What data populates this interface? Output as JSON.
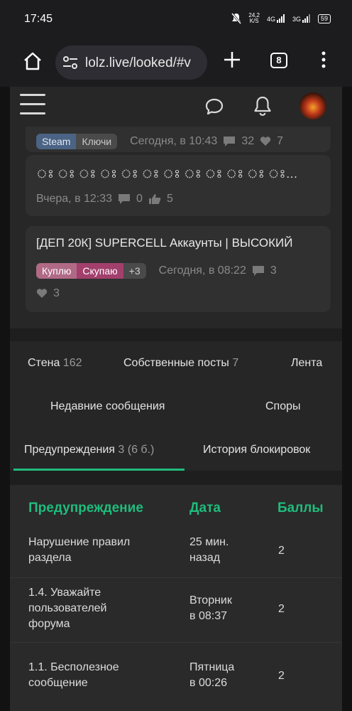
{
  "status_bar": {
    "time": "17:45",
    "net_speed": "24,2",
    "net_unit": "K/S",
    "net_type_1": "4G",
    "net_type_2": "3G",
    "battery": "59"
  },
  "browser": {
    "url": "lolz.live/looked/#v",
    "tab_count": "8"
  },
  "threads": [
    {
      "tags": [
        "Steam",
        "Ключи"
      ],
      "time": "Сегодня, в 10:43",
      "replies": "32",
      "likes": "7"
    },
    {
      "title": "ঃ ঃ ঃ ঃ ঃ ঃ ঃ ঃ ঃ ঃ ঃ ঃ ঃ ঃ ঃ ঃ ঃ ঃ ঃ ঃ ঃ ঃ ঃ ঃ ঃ",
      "time": "Вчера, в 12:33",
      "replies": "0",
      "likes": "5"
    },
    {
      "title": "[ДЕП 20К] SUPERCELL Аккаунты | ВЫСОКИЙ",
      "tags": [
        "Куплю",
        "Скупаю",
        "+3"
      ],
      "time": "Сегодня, в 08:22",
      "replies": "3",
      "likes": "3"
    }
  ],
  "tabs": {
    "wall": {
      "label": "Стена",
      "count": "162"
    },
    "own_posts": {
      "label": "Собственные посты",
      "count": "7"
    },
    "feed": {
      "label": "Лента"
    },
    "recent_messages": {
      "label": "Недавние сообщения"
    },
    "disputes": {
      "label": "Споры"
    },
    "warnings": {
      "label": "Предупреждения",
      "count": "3 (6 б.)"
    },
    "ban_history": {
      "label": "История блокировок"
    }
  },
  "warnings_table": {
    "headers": [
      "Предупреждение",
      "Дата",
      "Баллы"
    ],
    "rows": [
      {
        "reason_1": "Нарушение правил",
        "reason_2": "раздела",
        "reason_3": "",
        "date_1": "25 мин.",
        "date_2": "назад",
        "points": "2"
      },
      {
        "reason_1": "1.4. Уважайте",
        "reason_2": "пользователей",
        "reason_3": "форума",
        "date_1": "Вторник",
        "date_2": "в 08:37",
        "points": "2"
      },
      {
        "reason_1": "1.1. Бесполезное",
        "reason_2": "сообщение",
        "reason_3": "",
        "date_1": "Пятница",
        "date_2": "в 00:26",
        "points": "2"
      }
    ]
  },
  "colors": {
    "accent": "#1fbc7c",
    "tag_steam": "#4b6384",
    "tag_buy": "#b06a86",
    "tag_sell": "#a23f6c"
  }
}
